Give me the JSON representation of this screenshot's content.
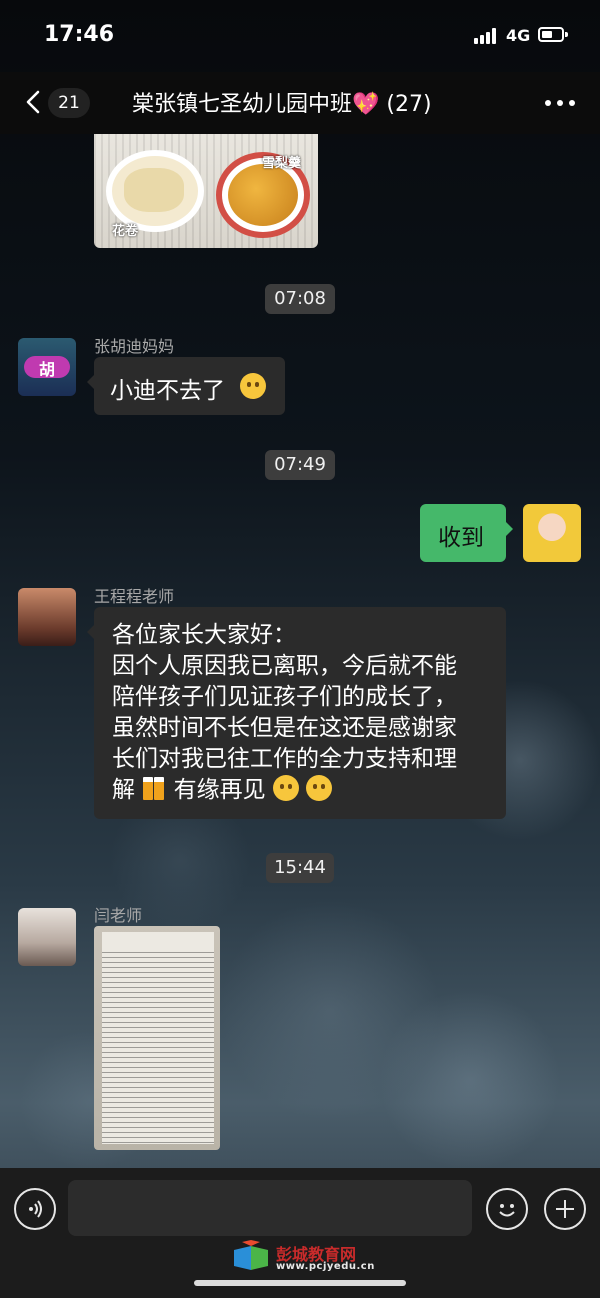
{
  "status_bar": {
    "time": "17:46",
    "network": "4G"
  },
  "header": {
    "unread_count": "21",
    "title": "棠张镇七圣幼儿园中班💖 (27)"
  },
  "messages": [
    {
      "type": "image",
      "captions": [
        "花卷",
        "雪梨羹"
      ]
    },
    {
      "type": "time",
      "text": "07:08"
    },
    {
      "type": "text",
      "sender": "张胡迪妈妈",
      "text": "小迪不去了"
    },
    {
      "type": "time",
      "text": "07:49"
    },
    {
      "type": "text",
      "mine": true,
      "text": "收到"
    },
    {
      "type": "text",
      "sender": "王程程老师",
      "lines": [
        "各位家长大家好：",
        "因个人原因我已离职，今后就不能",
        "陪伴孩子们见证孩子们的成长了，",
        "虽然时间不长但是在这还是感谢家",
        "长们对我已往工作的全力支持和理",
        "解",
        "有缘再见"
      ]
    },
    {
      "type": "time",
      "text": "15:44"
    },
    {
      "type": "image",
      "sender": "闫老师"
    }
  ],
  "avatar_text": {
    "zhang": "胡"
  },
  "watermark": {
    "name": "彭城教育网",
    "url": "www.pcjyedu.cn"
  },
  "colors": {
    "accent_green": "#45b86a",
    "bubble_dark": "#2b2b2b",
    "nav_bg": "#0c0c0c"
  }
}
